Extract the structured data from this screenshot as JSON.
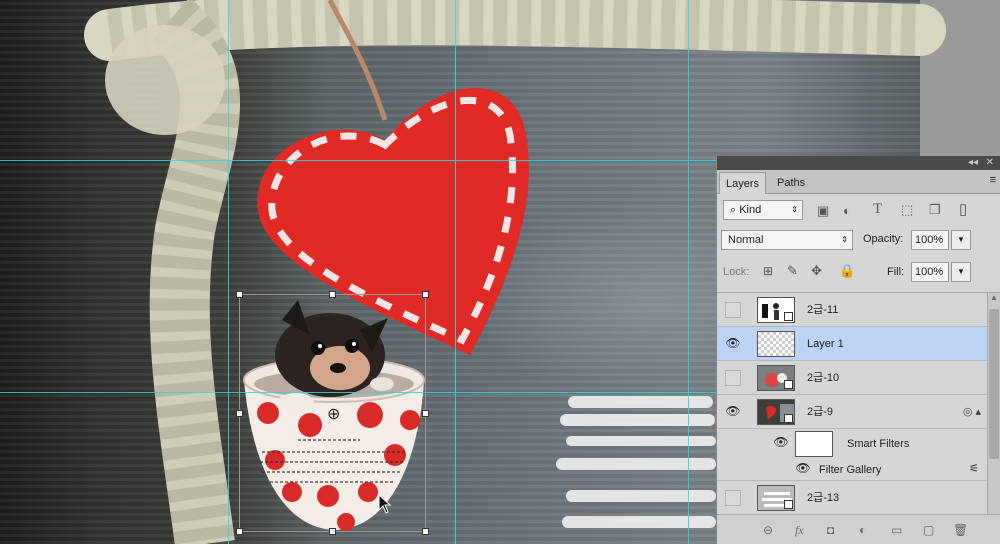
{
  "panel": {
    "collapse_glyph": "◂◂",
    "close_glyph": "✕",
    "tabs": [
      {
        "label": "Layers"
      },
      {
        "label": "Paths"
      }
    ],
    "menu_glyph": "≡",
    "filter": {
      "placeholder": "Kind",
      "icon": "search-icon"
    },
    "blend_mode": "Normal",
    "opacity_label": "Opacity:",
    "opacity_value": "100%",
    "lock_label": "Lock:",
    "fill_label": "Fill:",
    "fill_value": "100%"
  },
  "layers": [
    {
      "name": "2급-11",
      "visible": false,
      "selected": false
    },
    {
      "name": "Layer 1",
      "visible": true,
      "selected": true
    },
    {
      "name": "2급-10",
      "visible": false,
      "selected": false
    },
    {
      "name": "2급-9",
      "visible": true,
      "selected": false
    },
    {
      "name": "Smart Filters",
      "visible": true,
      "sub": true
    },
    {
      "name": "Filter Gallery",
      "visible": true,
      "sub": true
    },
    {
      "name": "2급-13",
      "visible": false,
      "selected": false
    }
  ],
  "canvas": {
    "guide_color": "#2fd6e6",
    "heart_color": "#e02a25",
    "cup_dot_color": "#d92a2a"
  },
  "icons": {
    "eye": "eye-icon",
    "link": "link-layers-icon",
    "fx": "fx-icon",
    "mask": "add-mask-icon",
    "adjust": "adjustment-layer-icon",
    "group": "folder-icon",
    "new": "new-layer-icon",
    "trash": "trash-icon"
  },
  "bottom_bar_glyphs": [
    "⊖",
    "fx",
    "◘",
    "◐",
    "▭",
    "▢",
    "🗑"
  ]
}
